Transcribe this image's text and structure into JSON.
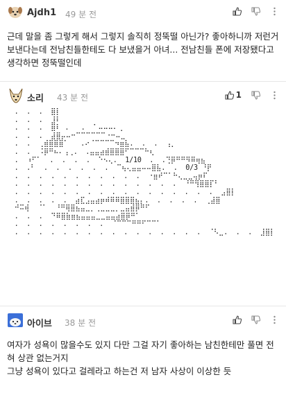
{
  "comments": [
    {
      "author": "Ajdh1",
      "time": "49 분 전",
      "like_count": "",
      "avatar_icon": "puppy-avatar-icon",
      "text": "근데 말을 좀 그렇게 해서 그렇지 솔직히 정뚝떨 아닌가? 좋아하니까 저런거 보낸다는데 전남친들한테도 다 보냈을거 아녀... 전남친들 폰에 저장됐다고 생각하면 정뚝떨인데"
    },
    {
      "author": "소리",
      "time": "43 분 전",
      "like_count": "1",
      "avatar_icon": "fox-avatar-icon",
      "ascii_art": "  .  .  .  ⣿⡇\n  .  .  .  ⣸⠇\n  .  .  .  ⣿⠇ .   .  ⠁⠤⠤⠤⠄⢀\n  .  .  .  ⣼⣿⡤⠤⠒⠉⠉⠉⠉⠉⠉⠐⠒⠤⣀\n  .  .  ⢀⣾⣿⣿⣿⠁   .⠔⠈⠉⠉⠉⠉⠲⣶⣧.  .  .  ⢠⡀\n  .  .  ⠨⡿⠛⠦⠄⢠⢀.  .⣤⣤⣴⣾⣿⣿⣿⠋⠉⠉⠉⠓⢆\n  .  ⠰⠋⠁  .  .  .  .  ⠑⠢⢄.  1/10  .  .⢙⡿⠛⠛⠻⠿⢶⣦\n  .  .⠃  .  .  .  .  .  .  ⠉⢦⢄⣤⣤⠤⠤⣿⣧.  .  0/3 ⠘⡟\n  .  .  .  .  .  .  .  .  .  .  .  ⠐⣶⠞⠉⠁⠓⢄⣀⣀⢤⡶⠏\n  .  .  .  .  .  .  .  .  .  .  .  .  .  .  ⠘⠛⢻⣿⣿⡏⠃\n  .  .  .  .  .  .  .  .  .  .  .  .  .  .  .  .  .  ⣠⣿⡇\n  .  .  .  .  .  ⣴⣏⣠⣤⣴⡶⠾⠿⠿⣿⣿⣿⣦⡄.  .  .  .  .  ⢀⣼⣿\n  ⠚⠭⢾  ⠈⠁  ⠘⠛⢿⣿⣦⣤⣀⡀⢀⣀⣀⣀⡀⣀⣤⣾⡿⠛⠋\n  .  .  .  ⠙⠿⣿⣷⣶⣦⣤⣤⣤⣀⣀⣤⣤⣴⣿⡿⠛⠁\n  .  .  .  .  .  .  .  .  ⠈⠉⠉⠉⠛⠛⠋⠉⠉⠁\n  .  .  .  .  .  .  .  .  .  .  .  .  .  .  .  .  ⠈⠣⣀.  .  .  ⣸⣿⡇"
    },
    {
      "author": "아이브",
      "time": "38 분 전",
      "like_count": "",
      "avatar_icon": "snowy-avatar-icon",
      "text": "여자가 성욕이 많을수도 있지 다만 그걸 자기 좋아하는 남친한테만 풀면 전혀 상관 없는거지\n그냥 성욕이 있다고 걸레라고 하는건 저 남자 사상이 이상한 듯"
    }
  ],
  "colors": {
    "text": "#222222",
    "meta": "#999999",
    "divider": "#e6e6e6",
    "icon": "#8a8a8a"
  }
}
